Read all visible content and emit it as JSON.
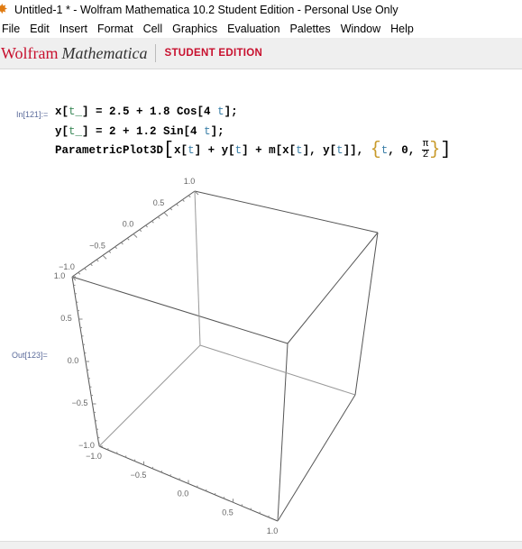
{
  "window": {
    "title": "Untitled-1 * - Wolfram Mathematica 10.2 Student Edition - Personal Use Only",
    "icon": "mathematica-spikey-icon"
  },
  "menu": [
    "File",
    "Edit",
    "Insert",
    "Format",
    "Cell",
    "Graphics",
    "Evaluation",
    "Palettes",
    "Window",
    "Help"
  ],
  "brand": {
    "wolfram": "Wolfram",
    "mathematica": "Mathematica",
    "edition": "STUDENT EDITION",
    "color": "#c8102e"
  },
  "cells": {
    "in_label": "In[121]:=",
    "line1": {
      "a": "x[",
      "t": "t_",
      "b": "] = 2.5 + 1.8 Cos[4 ",
      "t2": "t",
      "c": "];"
    },
    "line2": {
      "a": "y[",
      "t": "t_",
      "b": "] = 2 + 1.2 Sin[4 ",
      "t2": "t",
      "c": "];"
    },
    "line3": {
      "fn": "ParametricPlot3D",
      "body1": "x[",
      "t1": "t",
      "body2": "] + y[",
      "t2": "t",
      "body3": "] + m[x[",
      "t3": "t",
      "body4": "], y[",
      "t4": "t",
      "body5": "]],",
      "iter_var": "t",
      "iter_start": ", 0, ",
      "num": "π",
      "den": "2"
    },
    "out_label": "Out[123]="
  },
  "chart_data": {
    "type": "line",
    "dimension": "3d",
    "series": [],
    "xlim": [
      -1,
      1
    ],
    "ylim": [
      -1,
      1
    ],
    "zlim": [
      -1,
      1
    ],
    "x_ticks": [
      "-1.0",
      "-0.5",
      "0.0",
      "0.5",
      "1.0"
    ],
    "y_ticks": [
      "-1.0",
      "-0.5",
      "0.0",
      "0.5",
      "1.0"
    ],
    "z_ticks": [
      "-1.0",
      "-0.5",
      "0.0",
      "0.5",
      "1.0"
    ],
    "boxed": true,
    "grid": false
  }
}
